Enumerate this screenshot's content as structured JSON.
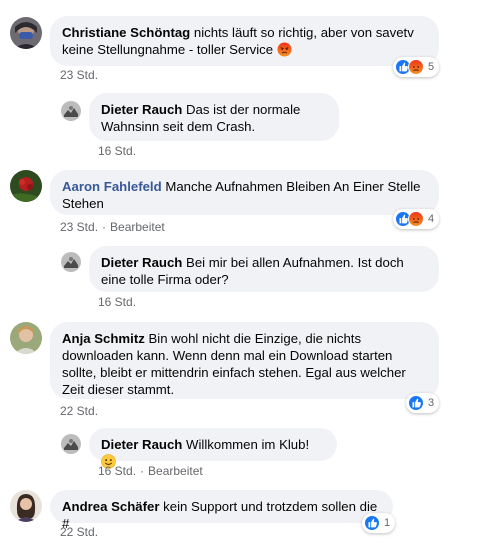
{
  "comments": [
    {
      "author": "Christiane Schöntag",
      "text": "nichts läuft so richtig, aber von savetv keine Stellungnahme - toller Service",
      "time": "23 Std.",
      "reaction_count": "5",
      "reactions": [
        "like-icon",
        "angry-icon"
      ]
    },
    {
      "author": "Dieter Rauch",
      "text": "Das ist der normale Wahnsinn seit dem Crash.",
      "time": "16 Std."
    },
    {
      "author": "Aaron Fahlefeld",
      "text": "Manche Aufnahmen Bleiben An Einer Stelle Stehen",
      "time": "23 Std.",
      "edited": "Bearbeitet",
      "reaction_count": "4",
      "reactions": [
        "like-icon",
        "angry-icon"
      ]
    },
    {
      "author": "Dieter Rauch",
      "text": "Bei mir bei allen Aufnahmen. Ist doch eine tolle Firma oder?",
      "time": "16 Std."
    },
    {
      "author": "Anja Schmitz",
      "text": "Bin wohl nicht die Einzige, die nichts downloaden kann. Wenn denn mal ein Download starten sollte, bleibt er mittendrin einfach stehen. Egal aus welcher Zeit dieser stammt.",
      "time": "22 Std.",
      "reaction_count": "3",
      "reactions": [
        "like-icon"
      ]
    },
    {
      "author": "Dieter Rauch",
      "text": "Willkommen im Klub!",
      "time": "16 Std.",
      "edited": "Bearbeitet"
    },
    {
      "author": "Andrea Schäfer",
      "text": "kein Support und trotzdem sollen die #",
      "time": "22 Std.",
      "reaction_count": "1",
      "reactions": [
        "like-icon"
      ]
    }
  ],
  "colors": {
    "bubble": "#f0f2f5",
    "link_author": "#385898",
    "meta": "#65676b",
    "like": "#1877f2",
    "angry": "#f0341a"
  }
}
